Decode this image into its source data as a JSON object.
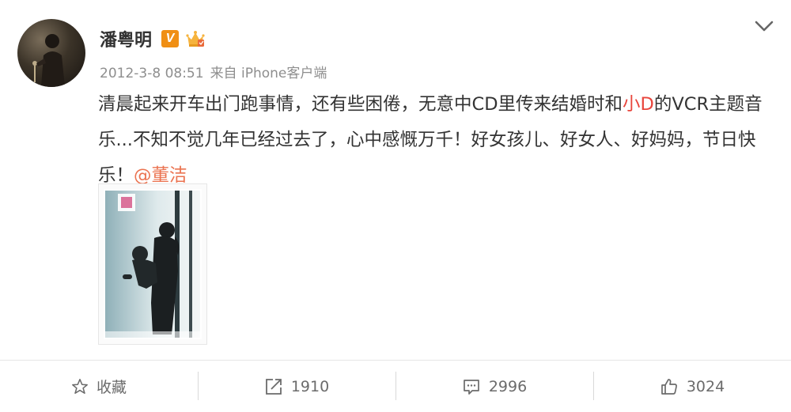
{
  "post": {
    "user": {
      "name": "潘粤明",
      "verified_badge": "V",
      "avatar_icon": "avatar",
      "member_icon": "crown-icon"
    },
    "timestamp": "2012-3-8 08:51",
    "source": "来自 iPhone客户端",
    "content": {
      "text_1": "清晨起来开车出门跑事情，还有些困倦，无意中CD里传来结婚时和",
      "highlight": "小D",
      "text_2": "的VCR主题音乐...不知不觉几年已经过去了，心中感慨万千！好女孩儿、好女人、好妈妈，节日快乐！",
      "mention": "@董洁"
    },
    "more_icon": "chevron-down-icon"
  },
  "actions": {
    "favorite_label": "收藏",
    "repost_count": "1910",
    "comment_count": "2996",
    "like_count": "3024"
  },
  "colors": {
    "highlight": "#e8453c",
    "mention": "#eb7350",
    "badge": "#f08f14"
  }
}
